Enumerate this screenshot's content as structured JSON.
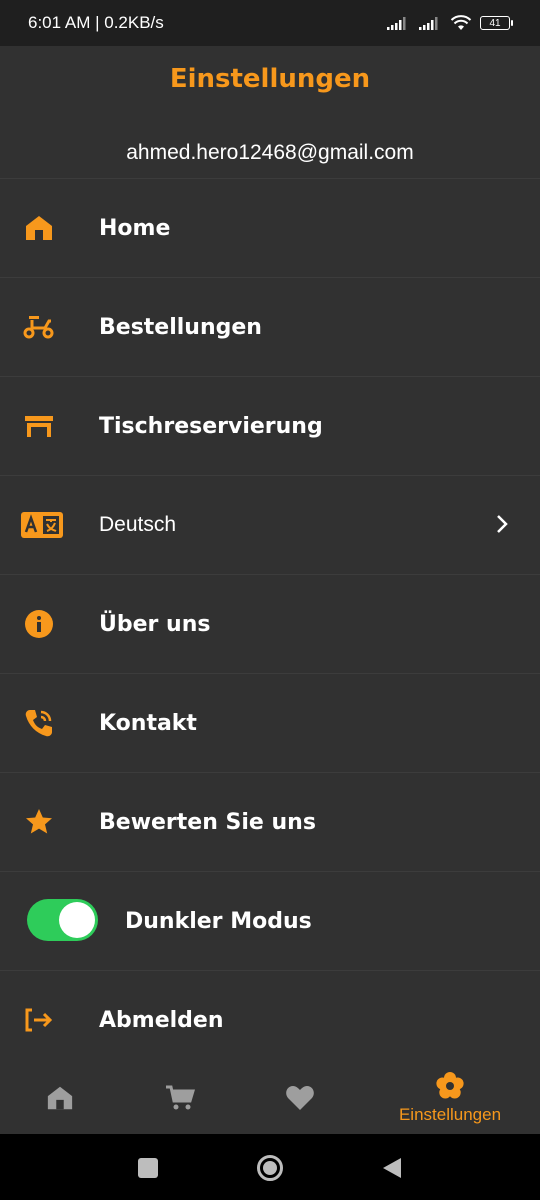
{
  "status_bar": {
    "time": "6:01 AM | 0.2KB/s",
    "battery": "41"
  },
  "header": {
    "title": "Einstellungen",
    "email": "ahmed.hero12468@gmail.com"
  },
  "menu": {
    "home": "Home",
    "orders": "Bestellungen",
    "table_reservation": "Tischreservierung",
    "language": "Deutsch",
    "about": "Über uns",
    "contact": "Kontakt",
    "rate": "Bewerten Sie uns",
    "dark_mode": "Dunkler Modus",
    "dark_mode_enabled": true,
    "logout": "Abmelden"
  },
  "bottom_nav": {
    "active_label": "Einstellungen"
  },
  "colors": {
    "accent": "#f7981c",
    "background": "#313131",
    "toggle_on": "#2ecc5a"
  }
}
